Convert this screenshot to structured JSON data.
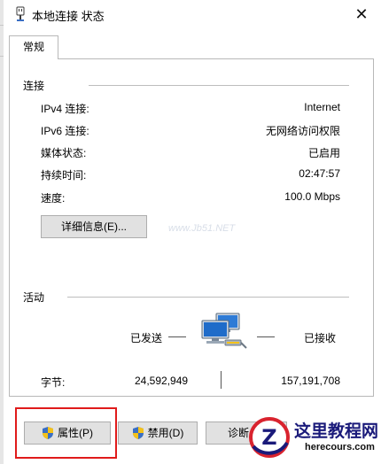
{
  "window": {
    "title": "本地连接 状态",
    "close_glyph": "✕"
  },
  "tabs": [
    {
      "label": "常规",
      "selected": true
    }
  ],
  "connection": {
    "section_title": "连接",
    "rows": [
      {
        "label": "IPv4 连接:",
        "value": "Internet"
      },
      {
        "label": "IPv6 连接:",
        "value": "无网络访问权限"
      },
      {
        "label": "媒体状态:",
        "value": "已启用"
      },
      {
        "label": "持续时间:",
        "value": "02:47:57"
      },
      {
        "label": "速度:",
        "value": "100.0 Mbps"
      }
    ],
    "details_button": "详细信息(E)..."
  },
  "activity": {
    "section_title": "活动",
    "sent_label": "已发送",
    "received_label": "已接收",
    "bytes_label": "字节:",
    "bytes_sent": "24,592,949",
    "bytes_received": "157,191,708",
    "network_icon": "network-computers-icon"
  },
  "buttons": {
    "properties": "属性(P)",
    "disable": "禁用(D)",
    "diagnose": "诊断"
  },
  "watermark": "www.Jb51.NET",
  "branding": {
    "name": "这里教程网",
    "url": "herecours.com",
    "logo_letter": "Z"
  },
  "colors": {
    "highlight": "#e01b1b",
    "shield_blue": "#3a6fc4",
    "shield_yellow": "#f4c21a",
    "brand_red": "#d9232e",
    "brand_navy": "#1a1a7a"
  }
}
